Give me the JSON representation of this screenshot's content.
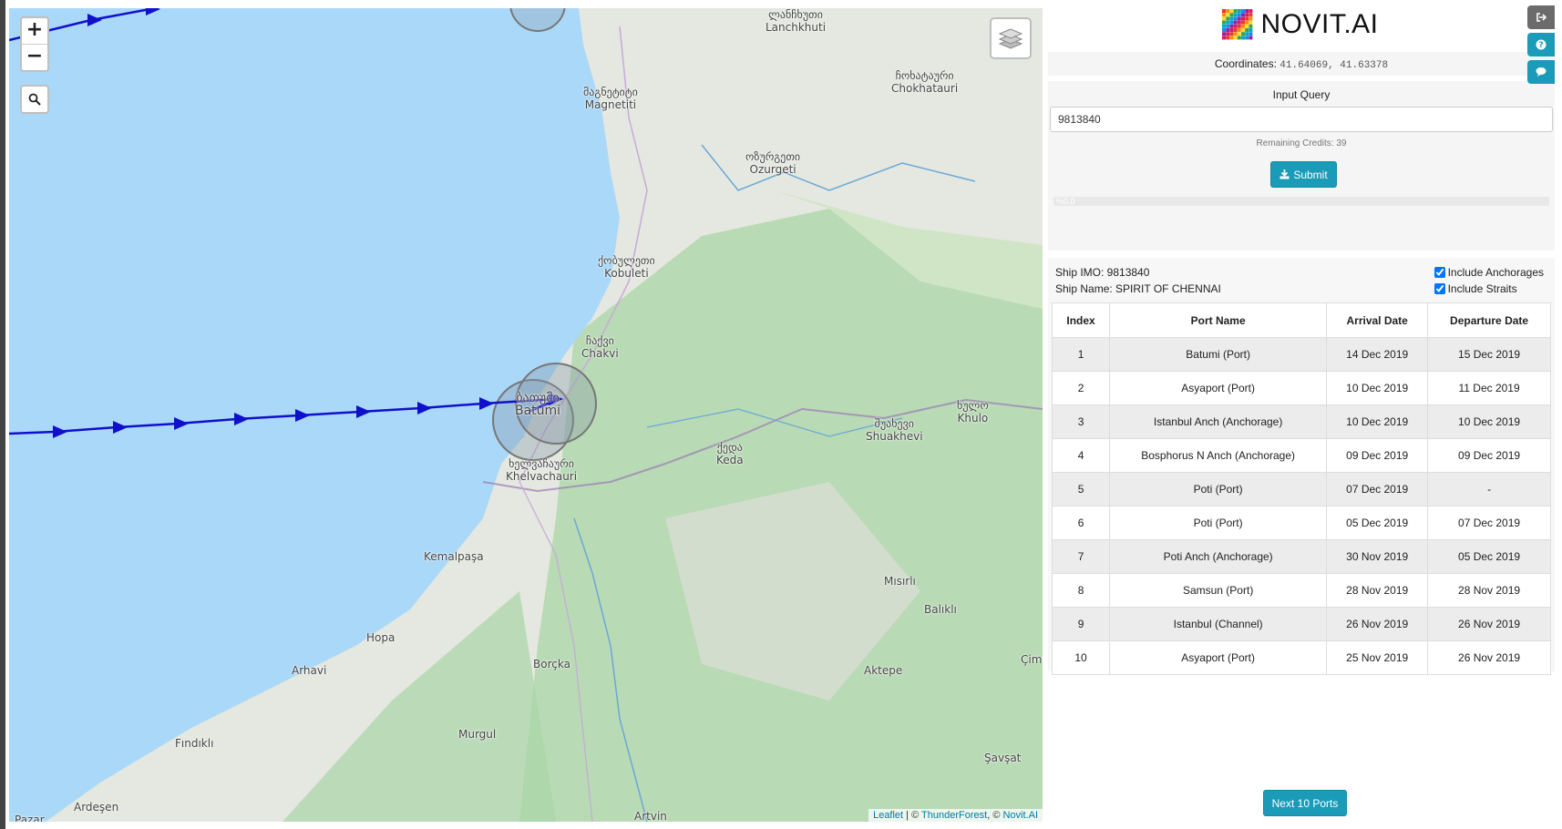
{
  "map": {
    "zoom_in": "+",
    "zoom_out": "−",
    "attribution": {
      "leaflet": "Leaflet",
      "sep1": " | © ",
      "thunderforest": "ThunderForest",
      "sep2": ", © ",
      "novit": "Novit.AI"
    },
    "places": [
      {
        "id": "lanchkhuti",
        "text": "ლანჩხუთი\nLanchkhuti"
      },
      {
        "id": "chokhatauri",
        "text": "ჩოხატაური\nChokhatauri"
      },
      {
        "id": "magnetiti",
        "text": "მაგნეტიტი\nMagnetiti"
      },
      {
        "id": "ozurgeti",
        "text": "ოზურგეთი\nOzurgeti"
      },
      {
        "id": "kobuleti",
        "text": "ქობულეთი\nKobuleti"
      },
      {
        "id": "chakvi",
        "text": "ჩაქვი\nChakvi"
      },
      {
        "id": "batumi",
        "text": "ბათუმი\nBatumi"
      },
      {
        "id": "khulo",
        "text": "ხულო\nKhulo"
      },
      {
        "id": "shuakhevi",
        "text": "შუახევი\nShuakhevi"
      },
      {
        "id": "keda",
        "text": "ქედა\nKeda"
      },
      {
        "id": "khelvachauri",
        "text": "ხელვაჩაური\nKhelvachauri"
      },
      {
        "id": "kemalpasa",
        "text": "Kemalpaşa"
      },
      {
        "id": "hopa",
        "text": "Hopa"
      },
      {
        "id": "arhavi",
        "text": "Arhavi"
      },
      {
        "id": "borcka",
        "text": "Borçka"
      },
      {
        "id": "misirli",
        "text": "Mısırlı"
      },
      {
        "id": "balikli",
        "text": "Balıklı"
      },
      {
        "id": "cim",
        "text": "Çim"
      },
      {
        "id": "aktepe",
        "text": "Aktepe"
      },
      {
        "id": "murgul",
        "text": "Murgul"
      },
      {
        "id": "findikli",
        "text": "Fındıklı"
      },
      {
        "id": "savsat",
        "text": "Şavşat"
      },
      {
        "id": "ardesen",
        "text": "Ardeşen"
      },
      {
        "id": "artvin",
        "text": "Artvin"
      },
      {
        "id": "pazar",
        "text": "Pazar"
      }
    ]
  },
  "header": {
    "logo_text": "NOVIT.AI",
    "coords_label": "Coordinates:",
    "coords_value": "41.64069, 41.63378"
  },
  "query": {
    "label": "Input Query",
    "value": "9813840",
    "credits": "Remaining Credits: 39",
    "submit": "Submit",
    "progress": "%0.0"
  },
  "ship": {
    "imo": "Ship IMO: 9813840",
    "name": "Ship Name: SPIRIT OF CHENNAI",
    "include_anchorages": "Include Anchorages",
    "include_straits": "Include Straits"
  },
  "table": {
    "headers": [
      "Index",
      "Port Name",
      "Arrival Date",
      "Departure Date"
    ],
    "rows": [
      [
        "1",
        "Batumi (Port)",
        "14 Dec 2019",
        "15 Dec 2019"
      ],
      [
        "2",
        "Asyaport (Port)",
        "10 Dec 2019",
        "11 Dec 2019"
      ],
      [
        "3",
        "Istanbul Anch (Anchorage)",
        "10 Dec 2019",
        "10 Dec 2019"
      ],
      [
        "4",
        "Bosphorus N Anch (Anchorage)",
        "09 Dec 2019",
        "09 Dec 2019"
      ],
      [
        "5",
        "Poti (Port)",
        "07 Dec 2019",
        "-"
      ],
      [
        "6",
        "Poti (Port)",
        "05 Dec 2019",
        "07 Dec 2019"
      ],
      [
        "7",
        "Poti Anch (Anchorage)",
        "30 Nov 2019",
        "05 Dec 2019"
      ],
      [
        "8",
        "Samsun (Port)",
        "28 Nov 2019",
        "28 Nov 2019"
      ],
      [
        "9",
        "Istanbul (Channel)",
        "26 Nov 2019",
        "26 Nov 2019"
      ],
      [
        "10",
        "Asyaport (Port)",
        "25 Nov 2019",
        "26 Nov 2019"
      ]
    ],
    "next_button": "Next 10 Ports"
  },
  "colors": {
    "accent": "#1a9bb8",
    "sea": "#aad8f8",
    "route": "#1010cc",
    "side_dark": "#6b6b6b"
  }
}
